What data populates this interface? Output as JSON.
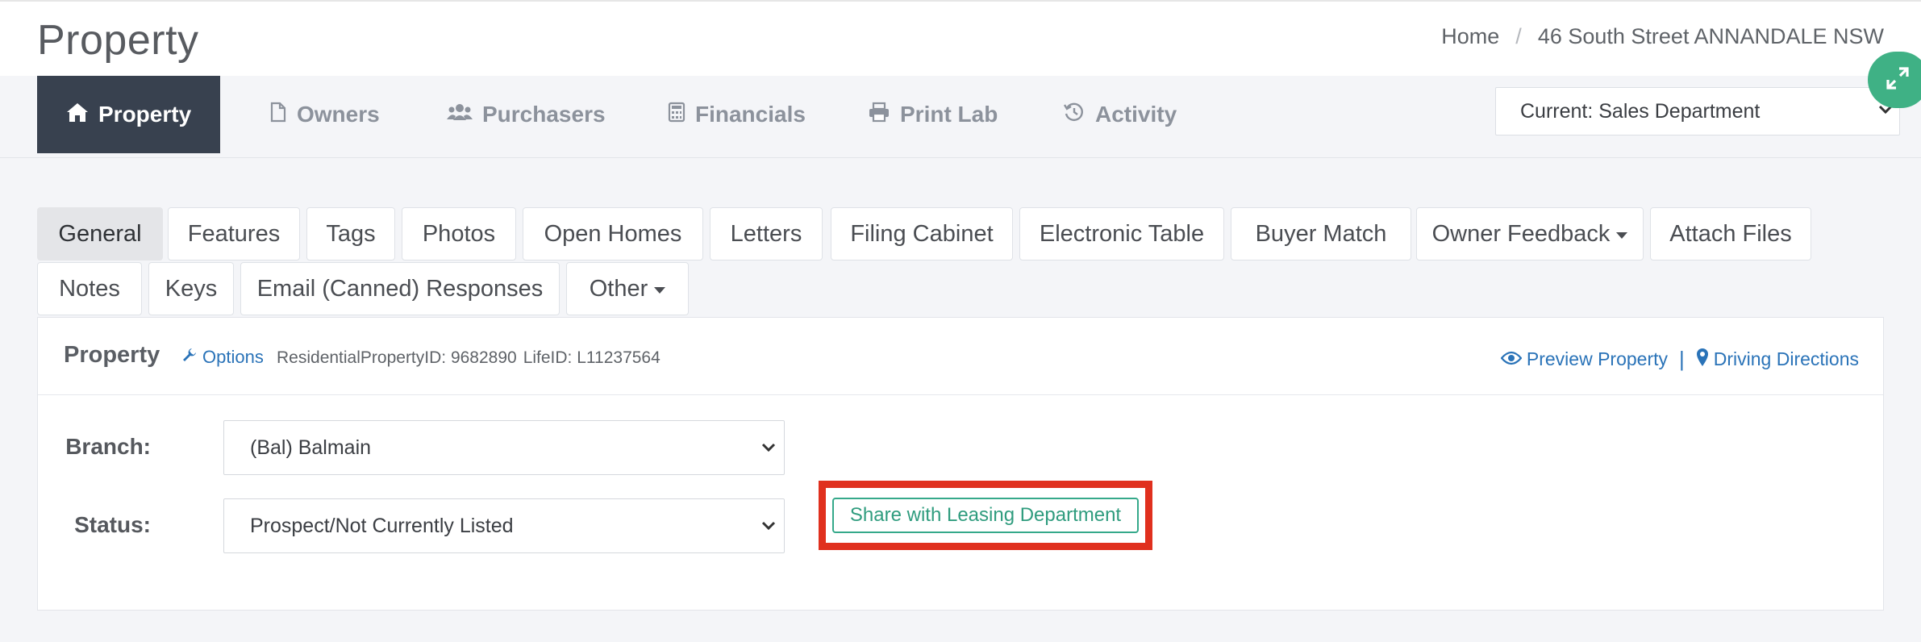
{
  "header": {
    "title": "Property",
    "breadcrumb": {
      "home": "Home",
      "separator": "/",
      "current": "46 South Street ANNANDALE NSW"
    },
    "expand_icon": "expand-icon"
  },
  "topnav": {
    "items": [
      {
        "label": "Property",
        "icon": "home-icon",
        "active": true
      },
      {
        "label": "Owners",
        "icon": "file-icon",
        "active": false
      },
      {
        "label": "Purchasers",
        "icon": "users-icon",
        "active": false
      },
      {
        "label": "Financials",
        "icon": "calculator-icon",
        "active": false
      },
      {
        "label": "Print Lab",
        "icon": "printer-icon",
        "active": false
      },
      {
        "label": "Activity",
        "icon": "history-icon",
        "active": false
      }
    ],
    "department_select": "Current: Sales Department"
  },
  "subtabs": {
    "items": [
      {
        "label": "General",
        "active": true
      },
      {
        "label": "Features"
      },
      {
        "label": "Tags"
      },
      {
        "label": "Photos"
      },
      {
        "label": "Open Homes"
      },
      {
        "label": "Letters"
      },
      {
        "label": "Filing Cabinet"
      },
      {
        "label": "Electronic Table"
      },
      {
        "label": "Buyer Match"
      },
      {
        "label": "Owner Feedback",
        "dropdown": true
      },
      {
        "label": "Attach Files"
      },
      {
        "label": "Notes"
      },
      {
        "label": "Keys"
      },
      {
        "label": "Email (Canned) Responses"
      },
      {
        "label": "Other",
        "dropdown": true
      }
    ]
  },
  "panel": {
    "title": "Property",
    "options_label": "Options",
    "property_type": "Residential",
    "property_id": "PropertyID: 9682890",
    "life_id": "LifeID: L11237564",
    "preview_label": "Preview Property",
    "divider": "|",
    "directions_label": "Driving Directions",
    "branch_label": "Branch:",
    "branch_value": "(Bal) Balmain",
    "status_label": "Status:",
    "status_value": "Prospect/Not Currently Listed",
    "share_button": "Share with Leasing Department"
  },
  "colors": {
    "nav_active_bg": "#38414f",
    "link": "#2a73b8",
    "share_green": "#35a98a",
    "highlight_red": "#e0301e",
    "expand_bg": "#3fb185"
  }
}
